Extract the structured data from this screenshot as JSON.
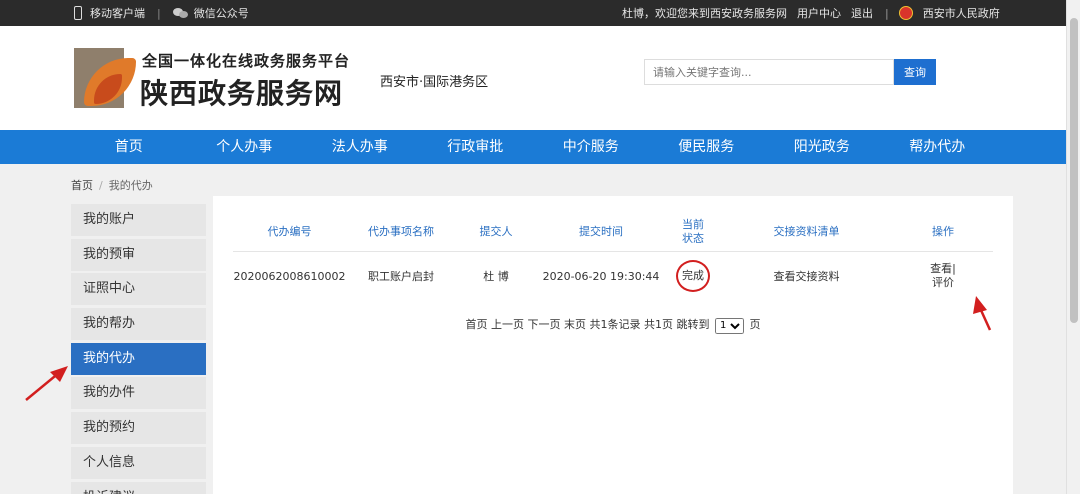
{
  "topbar": {
    "mobile": "移动客户端",
    "wechat": "微信公众号",
    "welcome": "杜博，欢迎您来到西安政务服务网",
    "user_center": "用户中心",
    "logout": "退出",
    "gov": "西安市人民政府"
  },
  "header": {
    "subtitle": "全国一体化在线政务服务平台",
    "title": "陕西政务服务网",
    "region": "西安市·国际港务区",
    "search_placeholder": "请输入关键字查询...",
    "search_button": "查询"
  },
  "nav": [
    "首页",
    "个人办事",
    "法人办事",
    "行政审批",
    "中介服务",
    "便民服务",
    "阳光政务",
    "帮办代办"
  ],
  "breadcrumb": {
    "home": "首页",
    "current": "我的代办"
  },
  "sidebar": [
    "我的账户",
    "我的预审",
    "证照中心",
    "我的帮办",
    "我的代办",
    "我的办件",
    "我的预约",
    "个人信息",
    "投诉建议"
  ],
  "table": {
    "headers": [
      "代办编号",
      "代办事项名称",
      "提交人",
      "提交时间",
      "当前状态",
      "交接资料清单",
      "操作"
    ],
    "row": {
      "id": "2020062008610002",
      "name": "职工账户启封",
      "submitter": "杜 博",
      "time": "2020-06-20 19:30:44",
      "status": "完成",
      "materials": "查看交接资料",
      "op_view": "查看|",
      "op_rate": "评价"
    }
  },
  "pager": {
    "first": "首页",
    "prev": "上一页",
    "next": "下一页",
    "last": "末页",
    "total_records": "共1条记录",
    "total_pages": "共1页",
    "jump": "跳转到",
    "page_option": "1",
    "page_unit": "页"
  },
  "colors": {
    "nav": "#1b7bd6",
    "accent": "#2a6fc2",
    "annotation": "#d21f1f"
  }
}
